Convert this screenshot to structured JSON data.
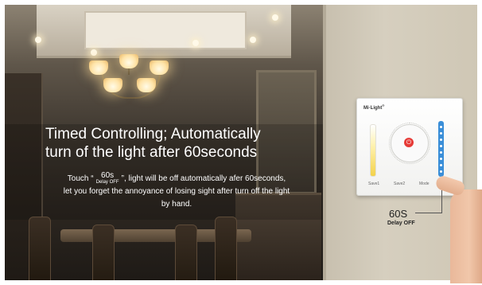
{
  "headline": {
    "line1": "Timed Controlling; Automatically",
    "line2": "turn of the light after 60seconds"
  },
  "body": {
    "prefix": "Touch “",
    "badge_top": "60s",
    "badge_bottom": "Delay OFF",
    "suffix": "”, light will be off automatically afer 60seconds,",
    "line2": "let you forget the annoyance of losing sight after turn off the light",
    "line3": "by hand."
  },
  "panel": {
    "brand": "Mi·Light",
    "brand_mark": "®",
    "buttons": [
      {
        "label": "Save1"
      },
      {
        "label": "Save2"
      },
      {
        "label": "Mode"
      }
    ],
    "power_icon": "power-icon",
    "accent_red": "#e63a36",
    "accent_blue": "#3a8ed8"
  },
  "callout": {
    "value": "60S",
    "label": "Delay OFF"
  }
}
